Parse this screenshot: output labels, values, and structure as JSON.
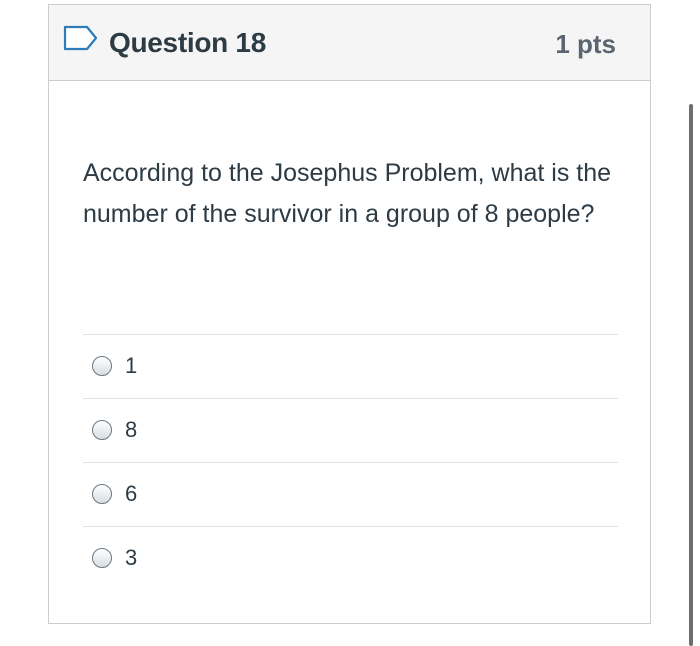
{
  "question": {
    "title": "Question 18",
    "points": "1 pts",
    "text": "According to the Josephus Problem, what is the number of the survivor in a group of 8 people?",
    "flag_icon": "flag-outline-icon"
  },
  "answers": [
    {
      "label": "1",
      "selected": false
    },
    {
      "label": "8",
      "selected": false
    },
    {
      "label": "6",
      "selected": false
    },
    {
      "label": "3",
      "selected": false
    }
  ],
  "colors": {
    "header_bg": "#f5f5f5",
    "border": "#c7cdd1",
    "text": "#2d3b45",
    "flag": "#2d7bb8"
  }
}
